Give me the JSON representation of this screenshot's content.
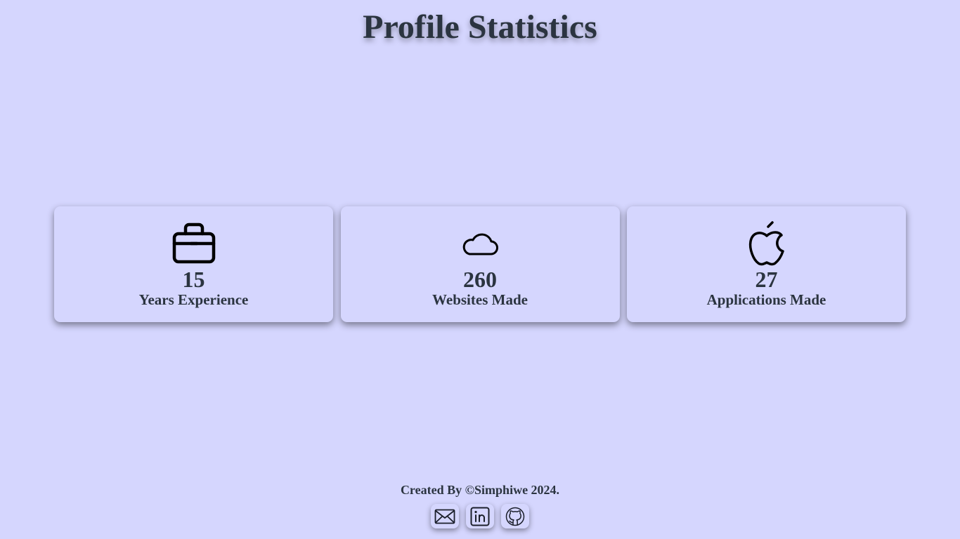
{
  "page": {
    "title": "Profile Statistics"
  },
  "stats": [
    {
      "icon": "briefcase-icon",
      "value": "15",
      "label": "Years Experience"
    },
    {
      "icon": "cloud-icon",
      "value": "260",
      "label": "Websites Made"
    },
    {
      "icon": "apple-icon",
      "value": "27",
      "label": "Applications Made"
    }
  ],
  "footer": {
    "credit": "Created By ©Simphiwe 2024.",
    "links": [
      {
        "icon": "mail-icon"
      },
      {
        "icon": "linkedin-icon"
      },
      {
        "icon": "github-icon"
      }
    ]
  },
  "colors": {
    "background": "#d5d6fe",
    "text": "#2b3440"
  }
}
